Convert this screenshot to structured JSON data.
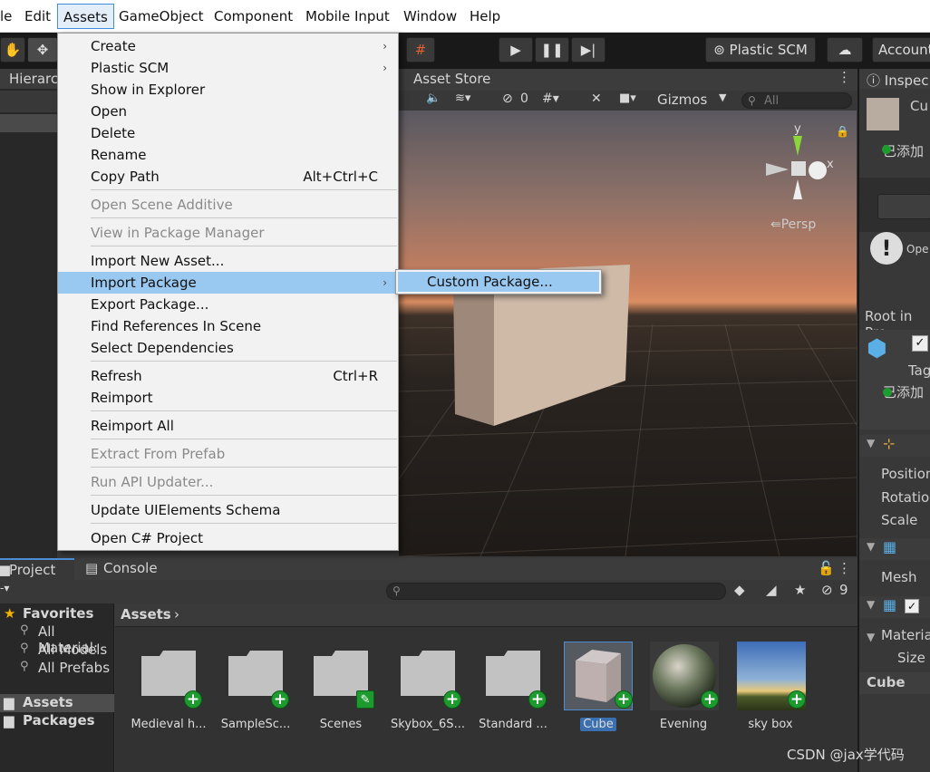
{
  "menubar": {
    "items": [
      "le",
      "Edit",
      "Assets",
      "GameObject",
      "Component",
      "Mobile Input",
      "Window",
      "Help"
    ]
  },
  "toolbar": {
    "plastic_scm": "Plastic SCM",
    "account": "Account"
  },
  "hierarchy": {
    "tab": "Hierarc"
  },
  "scene_view": {
    "tab": "Asset Store",
    "hidden_count": "0",
    "gizmos": "Gizmos",
    "search_placeholder": "All",
    "persp_label": "Persp",
    "axis_y": "y",
    "axis_x": "x"
  },
  "assets_menu": {
    "items": [
      {
        "label": "Create",
        "arrow": true
      },
      {
        "label": "Plastic SCM",
        "arrow": true
      },
      {
        "label": "Show in Explorer"
      },
      {
        "label": "Open"
      },
      {
        "label": "Delete"
      },
      {
        "label": "Rename"
      },
      {
        "label": "Copy Path",
        "shortcut": "Alt+Ctrl+C"
      },
      {
        "label": "Open Scene Additive",
        "disabled": true
      },
      {
        "label": "View in Package Manager",
        "disabled": true
      },
      {
        "label": "Import New Asset..."
      },
      {
        "label": "Import Package",
        "arrow": true,
        "highlighted": true
      },
      {
        "label": "Export Package..."
      },
      {
        "label": "Find References In Scene"
      },
      {
        "label": "Select Dependencies"
      },
      {
        "label": "Refresh",
        "shortcut": "Ctrl+R"
      },
      {
        "label": "Reimport"
      },
      {
        "label": "Reimport All"
      },
      {
        "label": "Extract From Prefab",
        "disabled": true
      },
      {
        "label": "Run API Updater...",
        "disabled": true
      },
      {
        "label": "Update UIElements Schema"
      },
      {
        "label": "Open C# Project"
      }
    ]
  },
  "import_submenu": {
    "custom_package": "Custom Package..."
  },
  "project": {
    "tab_project": "Project",
    "tab_console": "Console",
    "hidden_count": "9",
    "favorites": "Favorites",
    "fav_items": [
      "All Material:",
      "All Models",
      "All Prefabs"
    ],
    "assets_root": "Assets",
    "packages_root": "Packages",
    "breadcrumb": "Assets",
    "assets": [
      {
        "label": "Medieval h...",
        "kind": "folder"
      },
      {
        "label": "SampleSc...",
        "kind": "folder"
      },
      {
        "label": "Scenes",
        "kind": "folder-edit"
      },
      {
        "label": "Skybox_6S...",
        "kind": "folder"
      },
      {
        "label": "Standard ...",
        "kind": "folder"
      },
      {
        "label": "Cube",
        "kind": "cube",
        "selected": true
      },
      {
        "label": "Evening",
        "kind": "sphere"
      },
      {
        "label": "sky box",
        "kind": "sky"
      }
    ]
  },
  "inspector": {
    "tab": "Inspec",
    "object_name": "Cu",
    "added_label": "已添加",
    "open_label": "Ope",
    "root_label": "Root in Pre",
    "tag_label": "Tag",
    "added_label2": "已添加",
    "position": "Position",
    "rotation": "Rotation",
    "scale": "Scale",
    "mesh": "Mesh",
    "material": "Materia",
    "size": "Size",
    "cube_footer": "Cube"
  },
  "watermark": "CSDN @jax学代码"
}
